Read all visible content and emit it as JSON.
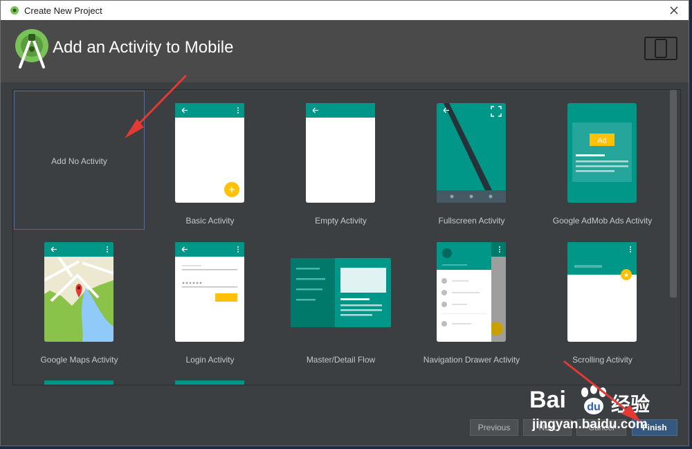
{
  "window": {
    "title": "Create New Project"
  },
  "header": {
    "title": "Add an Activity to Mobile"
  },
  "activities": [
    {
      "label": "Add No Activity",
      "selected": true
    },
    {
      "label": "Basic Activity"
    },
    {
      "label": "Empty Activity"
    },
    {
      "label": "Fullscreen Activity"
    },
    {
      "label": "Google AdMob Ads Activity",
      "badge": "Ad"
    },
    {
      "label": "Google Maps Activity"
    },
    {
      "label": "Login Activity"
    },
    {
      "label": "Master/Detail Flow"
    },
    {
      "label": "Navigation Drawer Activity"
    },
    {
      "label": "Scrolling Activity"
    }
  ],
  "buttons": {
    "previous": "Previous",
    "next": "Next",
    "cancel": "Cancel",
    "finish": "Finish"
  },
  "watermark": {
    "brand": "Bai",
    "brand_cn": "经验",
    "url": "jingyan.baidu.com"
  },
  "colors": {
    "accent": "#009688",
    "accent_dark": "#00796b",
    "fab": "#ffc107",
    "selection": "#4b6eaf",
    "annotation": "#e53935"
  }
}
